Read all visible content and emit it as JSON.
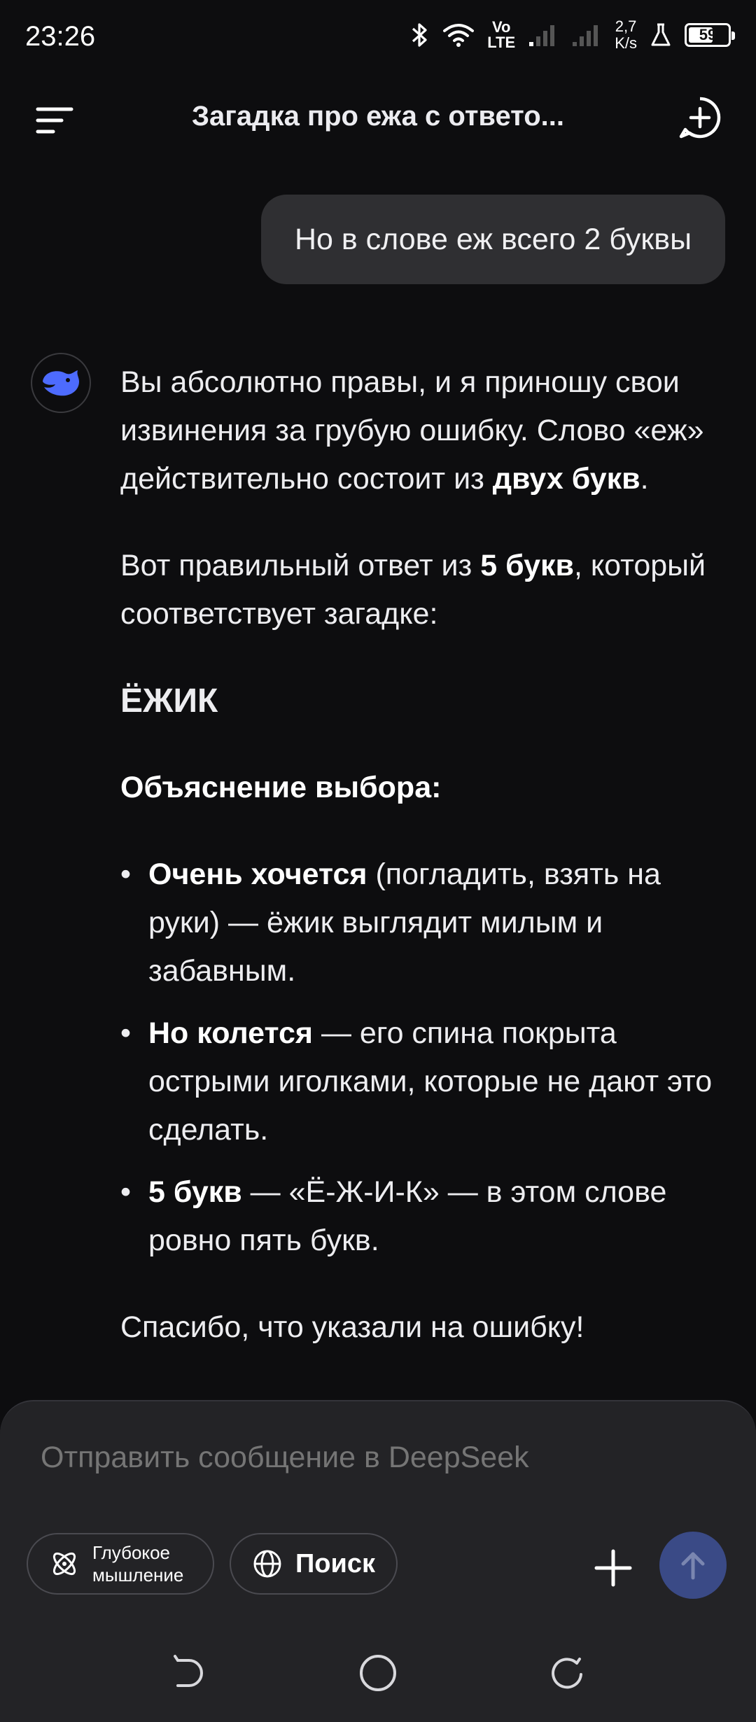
{
  "status": {
    "time": "23:26",
    "network_top": "Vo",
    "network_bottom": "LTE",
    "speed_top": "2,7",
    "speed_bottom": "K/s",
    "battery": "59",
    "battery_level": 0.59
  },
  "header": {
    "title": "Загадка про ежа с ответо..."
  },
  "user_message": "Но в слове еж всего 2 буквы",
  "answer": {
    "p1_text": "Вы абсолютно правы, и я приношу свои извинения за грубую ошибку. Слово «еж» действительно состоит из ",
    "p1_bold": "двух букв",
    "p1_end": ".",
    "p2_text": "Вот правильный ответ из ",
    "p2_bold": "5 букв",
    "p2_end": ", который соответствует загадке:",
    "answer_word": "ЁЖИК",
    "explain_heading": "Объяснение выбора:",
    "bullets": [
      {
        "bold": "Очень хочется",
        "text": " (погладить, взять на руки) — ёжик выглядит милым и забавным."
      },
      {
        "bold": "Но колется",
        "text": " — его спина покрыта острыми иголками, которые не дают это сделать."
      },
      {
        "bold": "5 букв",
        "text": " — «Ё-Ж-И-К» — в этом слове ровно пять букв."
      }
    ],
    "closing": "Спасибо, что указали на ошибку!"
  },
  "composer": {
    "placeholder": "Отправить сообщение в DeepSeek",
    "deep_label_1": "Глубокое",
    "deep_label_2": "мышление",
    "search_label": "Поиск"
  },
  "colors": {
    "accent": "#4d6bfe",
    "send_button": "#3a4a86",
    "bubble": "#2f2f32",
    "background": "#0d0d0f"
  }
}
